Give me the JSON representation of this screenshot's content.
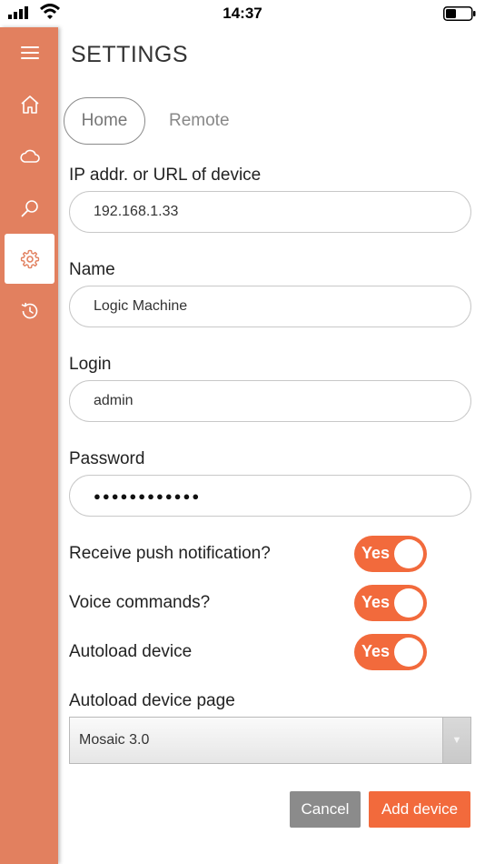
{
  "status_bar": {
    "time": "14:37"
  },
  "sidebar": {
    "items": [
      {
        "icon": "menu-icon"
      },
      {
        "icon": "home-icon"
      },
      {
        "icon": "cloud-icon"
      },
      {
        "icon": "search-icon"
      },
      {
        "icon": "gear-icon",
        "active": true
      },
      {
        "icon": "history-icon"
      }
    ],
    "color": "#e2805f"
  },
  "page": {
    "title": "SETTINGS"
  },
  "tabs": {
    "home": "Home",
    "remote": "Remote",
    "active": "Home"
  },
  "form": {
    "ip_label": "IP addr. or URL of device",
    "ip_value": "192.168.1.33",
    "name_label": "Name",
    "name_value": "Logic Machine",
    "login_label": "Login",
    "login_value": "admin",
    "password_label": "Password",
    "password_value": "●●●●●●●●●●●●",
    "push_label": "Receive push notification?",
    "push_value": "Yes",
    "voice_label": "Voice commands?",
    "voice_value": "Yes",
    "autoload_label": "Autoload device",
    "autoload_value": "Yes",
    "autoload_page_label": "Autoload device page",
    "autoload_page_value": "Mosaic 3.0"
  },
  "buttons": {
    "cancel": "Cancel",
    "add": "Add device"
  },
  "colors": {
    "accent": "#f26a3c",
    "cancel": "#8b8b8b"
  }
}
